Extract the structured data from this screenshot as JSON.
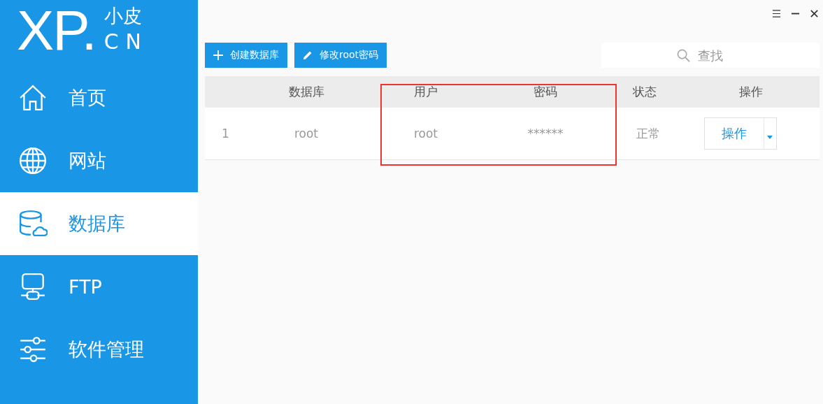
{
  "logo": {
    "mark": "XP.",
    "name": "小皮",
    "domain": "CN"
  },
  "sidebar": {
    "items": [
      {
        "label": "首页",
        "selected": false
      },
      {
        "label": "网站",
        "selected": false
      },
      {
        "label": "数据库",
        "selected": true
      },
      {
        "label": "FTP",
        "selected": false
      },
      {
        "label": "软件管理",
        "selected": false
      }
    ]
  },
  "toolbar": {
    "buttons": [
      {
        "label": "创建数据库"
      },
      {
        "label": "修改root密码"
      }
    ],
    "search": {
      "placeholder": "查找"
    }
  },
  "table": {
    "columns": [
      "",
      "数据库",
      "用户",
      "密码",
      "状态",
      "操作"
    ],
    "rows": [
      {
        "index": "1",
        "database": "root",
        "user": "root",
        "password": "******",
        "status": "正常",
        "action": "操作"
      }
    ]
  }
}
